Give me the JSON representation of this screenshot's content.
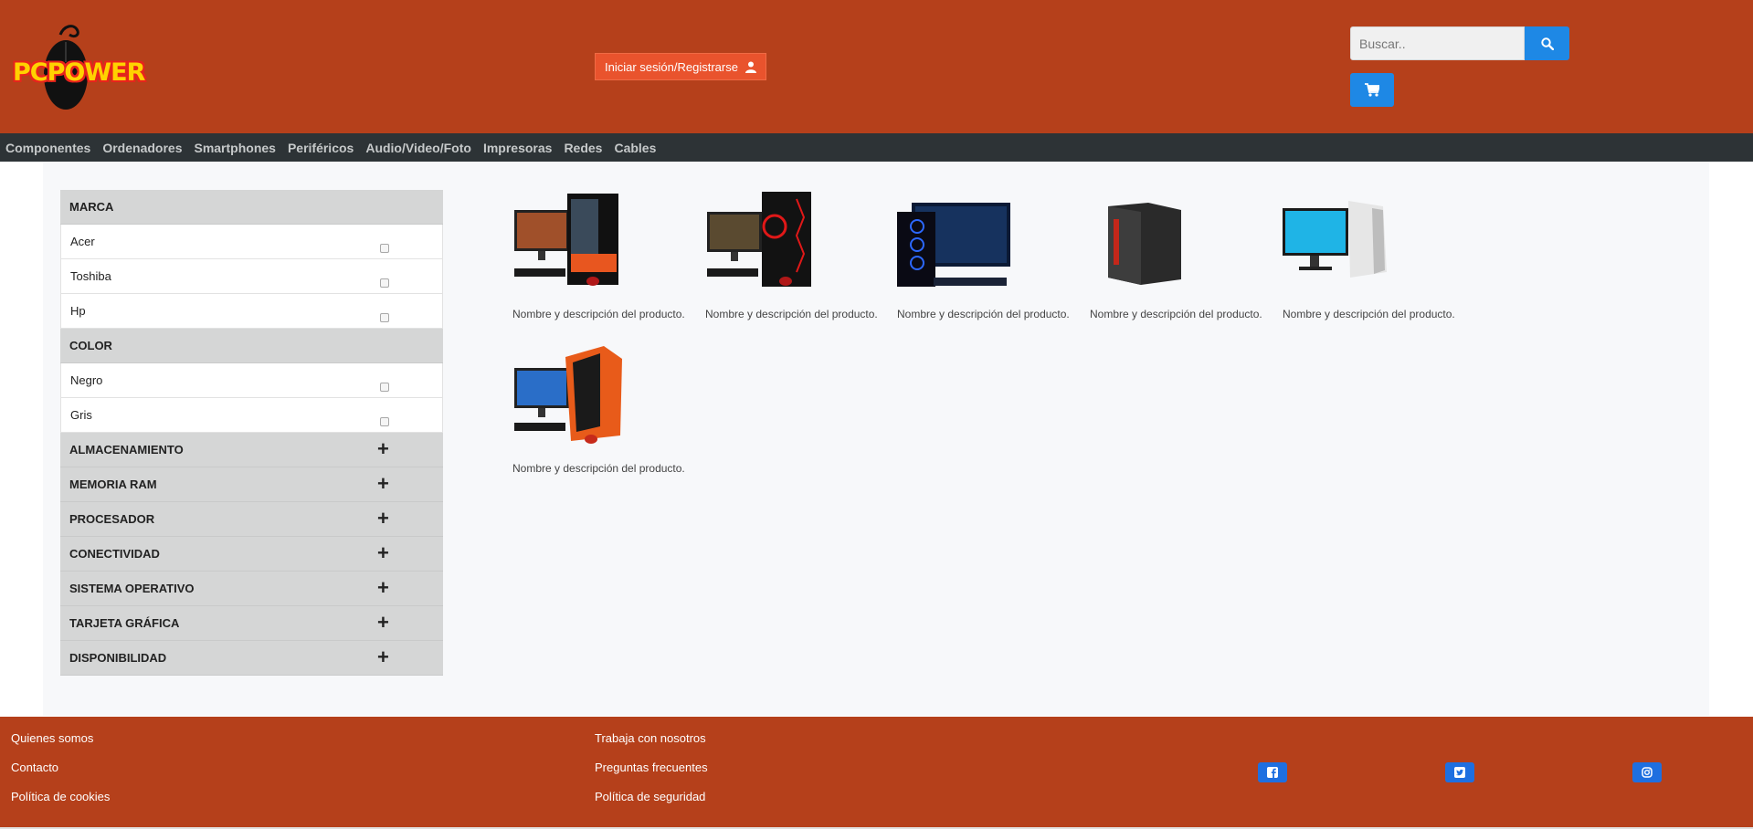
{
  "header": {
    "logo_text": "PCPOWER",
    "login_label": "Iniciar sesión/Registrarse",
    "search_placeholder": "Buscar.."
  },
  "nav": [
    "Componentes",
    "Ordenadores",
    "Smartphones",
    "Periféricos",
    "Audio/Video/Foto",
    "Impresoras",
    "Redes",
    "Cables"
  ],
  "filters": {
    "marca": {
      "title": "MARCA",
      "options": [
        "Acer",
        "Toshiba",
        "Hp"
      ]
    },
    "color": {
      "title": "COLOR",
      "options": [
        "Negro",
        "Gris"
      ]
    },
    "collapsed": [
      "ALMACENAMIENTO",
      "MEMORIA RAM",
      "PROCESADOR",
      "CONECTIVIDAD",
      "SISTEMA OPERATIVO",
      "TARJETA GRÁFICA",
      "DISPONIBILIDAD"
    ],
    "expand_symbol": "+"
  },
  "products": [
    {
      "description": "Nombre y descripción del producto."
    },
    {
      "description": "Nombre y descripción del producto."
    },
    {
      "description": "Nombre y descripción del producto."
    },
    {
      "description": "Nombre y descripción del producto."
    },
    {
      "description": "Nombre y descripción del producto."
    },
    {
      "description": "Nombre y descripción del producto."
    }
  ],
  "footer": {
    "col1": [
      "Quienes somos",
      "Contacto",
      "Política de cookies"
    ],
    "col2": [
      "Trabaja con nosotros",
      "Preguntas frecuentes",
      "Política de seguridad"
    ],
    "social_icons": [
      "facebook-icon",
      "twitter-icon",
      "instagram-icon"
    ]
  },
  "colors": {
    "brand": "#b5401b",
    "nav_bg": "#2d3336",
    "accent_blue": "#1e88e5",
    "login_bg": "#e9532d"
  }
}
